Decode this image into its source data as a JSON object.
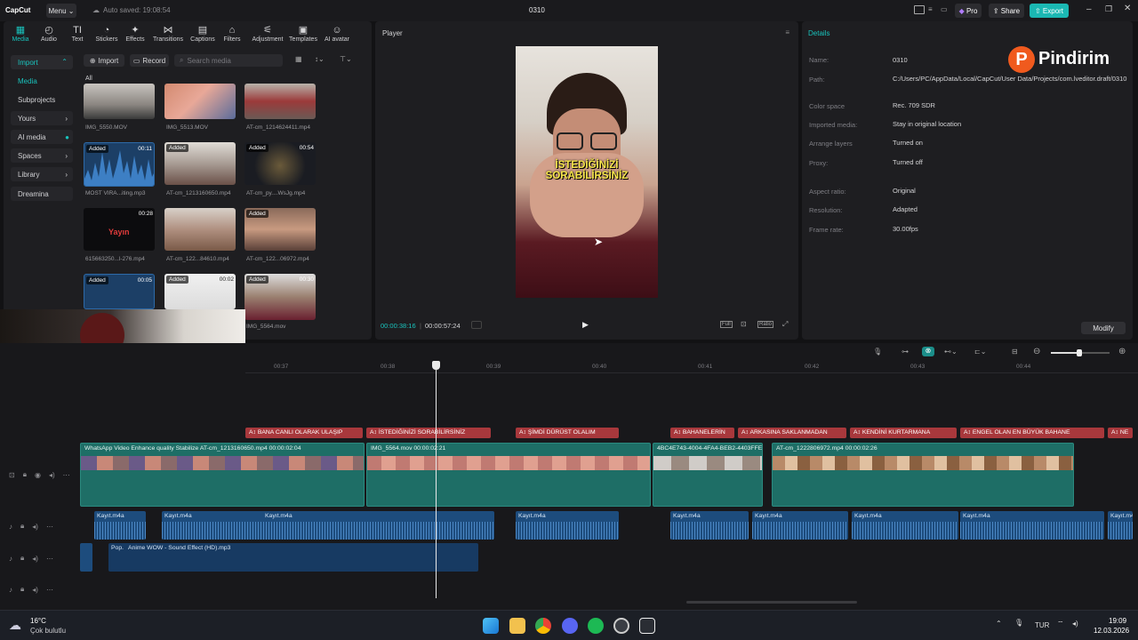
{
  "titlebar": {
    "app_name": "CapCut",
    "menu_label": "Menu",
    "autosave": "Auto saved: 19:08:54",
    "project_title": "0310",
    "pro_label": "Pro",
    "share_label": "Share",
    "export_label": "Export"
  },
  "toolbar": {
    "items": [
      "Media",
      "Audio",
      "Text",
      "Stickers",
      "Effects",
      "Transitions",
      "Captions",
      "Filters",
      "Adjustment",
      "Templates",
      "AI avatar"
    ]
  },
  "media_sidebar": {
    "items": [
      "Import",
      "Media",
      "Subprojects",
      "Yours",
      "AI media",
      "Spaces",
      "Library",
      "Dreamina"
    ]
  },
  "media_actions": {
    "import": "Import",
    "record": "Record",
    "search_placeholder": "Search media",
    "filter_all": "All"
  },
  "media_items": [
    {
      "name": "IMG_5550.MOV",
      "added": "",
      "dur": ""
    },
    {
      "name": "IMG_5513.MOV",
      "added": "",
      "dur": ""
    },
    {
      "name": "AT-cm_1214624411.mp4",
      "added": "",
      "dur": ""
    },
    {
      "name": "MOST VIRA...iting.mp3",
      "added": "Added",
      "dur": "00:11"
    },
    {
      "name": "AT-cm_1213160650.mp4",
      "added": "Added",
      "dur": "00:47"
    },
    {
      "name": "AT-cm_py....WsJg.mp4",
      "added": "Added",
      "dur": "00:54"
    },
    {
      "name": "615663250...l-276.mp4",
      "added": "",
      "dur": "00:28"
    },
    {
      "name": "AT-cm_122...84610.mp4",
      "added": "Added",
      "dur": "00:33"
    },
    {
      "name": "AT-cm_122...06972.mp4",
      "added": "Added",
      "dur": "00:17"
    },
    {
      "name": "",
      "added": "Added",
      "dur": "00:05"
    },
    {
      "name": "",
      "added": "Added",
      "dur": "00:02"
    },
    {
      "name": "IMG_5564.mov",
      "added": "Added",
      "dur": "00:30"
    }
  ],
  "thumb_text": {
    "yayin": "Yayın"
  },
  "player": {
    "title": "Player",
    "caption_line1": "İSTEDİĞİNİZİ",
    "caption_line2": "SORABİLİRSİNİZ",
    "current_time": "00:00:38:16",
    "total_time": "00:00:57:24",
    "full_label": "Full",
    "ratio_label": "Ratio"
  },
  "details": {
    "title": "Details",
    "watermark": "Pindirim",
    "modify_label": "Modify",
    "rows": [
      {
        "label": "Name:",
        "value": "0310"
      },
      {
        "label": "Path:",
        "value": "C:/Users/PC/AppData/Local/CapCut/User Data/Projects/com.lveditor.draft/0310"
      },
      {
        "label": "Color space",
        "value": "Rec. 709 SDR"
      },
      {
        "label": "Imported media:",
        "value": "Stay in original location"
      },
      {
        "label": "Arrange layers",
        "value": "Turned on"
      },
      {
        "label": "Proxy:",
        "value": "Turned off"
      },
      {
        "label": "Aspect ratio:",
        "value": "Original"
      },
      {
        "label": "Resolution:",
        "value": "Adapted"
      },
      {
        "label": "Frame rate:",
        "value": "30.00fps"
      }
    ]
  },
  "timeline": {
    "ruler": [
      "00:37",
      "00:38",
      "00:39",
      "00:40",
      "00:41",
      "00:42",
      "00:43",
      "00:44"
    ],
    "captions": [
      "BANA CANLI OLARAK ULAŞIP",
      "İSTEDİĞİNİZİ SORABİLİRSİNİZ",
      "ŞİMDİ DÜRÜST OLALIM",
      "BAHANELERİN",
      "ARKASINA SAKLANMADAN",
      "KENDİNİ KURTARMANA",
      "ENGEL OLAN EN BÜYÜK BAHANE",
      "NE"
    ],
    "video_clips": [
      {
        "label": "WhatsApp Video   Enhance quality   Stabilize   AT-cm_1213160650.mp4   00:00:02:04"
      },
      {
        "label": "IMG_5564.mov   00:00:02:21"
      },
      {
        "label": "4BC4E743-4004-4FA4-BEB2-4403FFE"
      },
      {
        "label": "AT-cm_1222806972.mp4   00:00:02:26"
      }
    ],
    "audio_clip_label": "Kayıt.m4a",
    "sfx_label": "Pop.",
    "sfx2_label": "Anime WOW - Sound Effect (HD).mp3"
  },
  "taskbar": {
    "temp": "16°C",
    "weather": "Çok bulutlu",
    "lang": "TUR",
    "time": "19:09",
    "date": "12.03.2026"
  }
}
